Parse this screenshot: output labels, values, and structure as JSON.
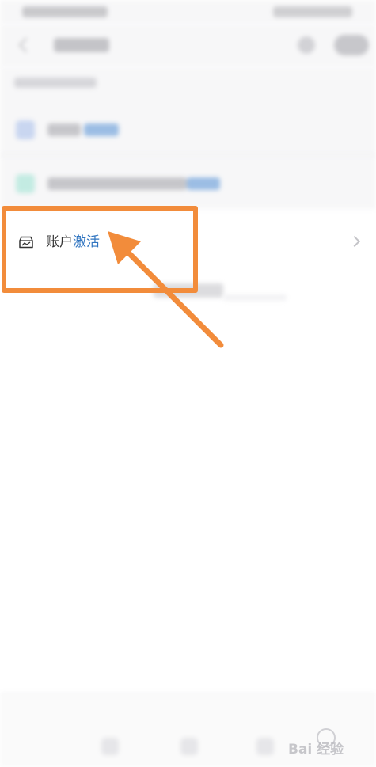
{
  "activate_row": {
    "label_part1": "账户",
    "label_part2": "激活",
    "icon": "wallet-chart-icon",
    "chevron_icon": "chevron-right-icon"
  },
  "annotation": {
    "highlight_color": "#f28c3b",
    "arrow_color": "#f28c3b"
  },
  "colors": {
    "accent": "#2f74c0",
    "text": "#333333",
    "background": "#ffffff"
  },
  "watermark": {
    "text": "Bai 经验",
    "icon": "baidu-paw-icon"
  }
}
